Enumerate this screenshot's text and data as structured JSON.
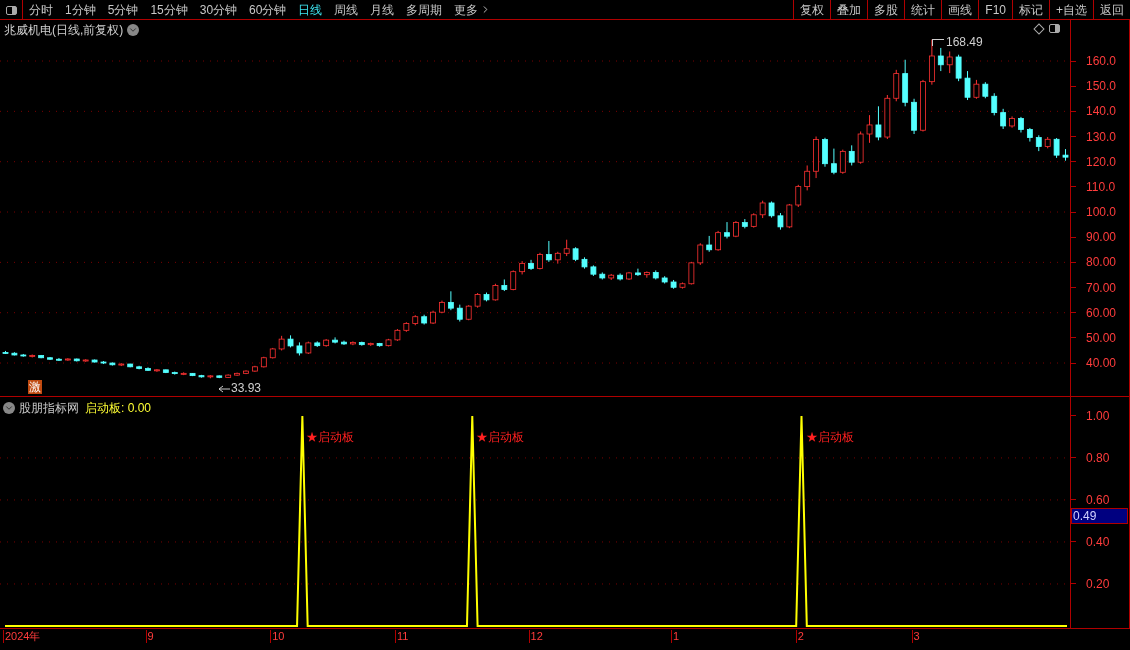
{
  "toolbar": {
    "periods": [
      {
        "label": "分时",
        "selected": false
      },
      {
        "label": "1分钟",
        "selected": false
      },
      {
        "label": "5分钟",
        "selected": false
      },
      {
        "label": "15分钟",
        "selected": false
      },
      {
        "label": "30分钟",
        "selected": false
      },
      {
        "label": "60分钟",
        "selected": false
      },
      {
        "label": "日线",
        "selected": true
      },
      {
        "label": "周线",
        "selected": false
      },
      {
        "label": "月线",
        "selected": false
      },
      {
        "label": "多周期",
        "selected": false
      },
      {
        "label": "更多",
        "selected": false
      }
    ],
    "actions": [
      "复权",
      "叠加",
      "多股",
      "统计",
      "画线",
      "F10",
      "标记",
      "+自选",
      "返回"
    ]
  },
  "price_pane": {
    "title": "兆威机电(日线,前复权)",
    "high_label": "168.49",
    "low_label": "33.93",
    "badge": "激",
    "chart_data": {
      "type": "candlestick",
      "ylim": [
        26.9,
        176.3
      ],
      "yticks": [
        {
          "value": 160,
          "label": "160.0"
        },
        {
          "value": 150,
          "label": "150.0"
        },
        {
          "value": 140,
          "label": "140.0"
        },
        {
          "value": 130,
          "label": "130.0"
        },
        {
          "value": 120,
          "label": "120.0"
        },
        {
          "value": 110,
          "label": "110.0"
        },
        {
          "value": 100,
          "label": "100.0"
        },
        {
          "value": 90,
          "label": "90.00"
        },
        {
          "value": 80,
          "label": "80.00"
        },
        {
          "value": 70,
          "label": "70.00"
        },
        {
          "value": 60,
          "label": "60.00"
        },
        {
          "value": 50,
          "label": "50.00"
        },
        {
          "value": 40,
          "label": "40.00"
        }
      ],
      "grid": true,
      "ohlc": [
        [
          44.2,
          44.8,
          43.6,
          43.9
        ],
        [
          43.9,
          44.3,
          43.0,
          43.2
        ],
        [
          43.2,
          43.6,
          42.5,
          42.8
        ],
        [
          42.8,
          43.4,
          42.2,
          43.0
        ],
        [
          43.0,
          43.2,
          41.9,
          42.1
        ],
        [
          42.1,
          42.4,
          41.2,
          41.5
        ],
        [
          41.5,
          42.0,
          40.8,
          41.2
        ],
        [
          41.2,
          41.9,
          40.9,
          41.6
        ],
        [
          41.6,
          41.8,
          40.6,
          40.9
        ],
        [
          40.9,
          41.5,
          40.5,
          41.2
        ],
        [
          41.2,
          41.4,
          40.2,
          40.4
        ],
        [
          40.4,
          40.8,
          39.6,
          40.0
        ],
        [
          40.0,
          40.2,
          39.0,
          39.3
        ],
        [
          39.3,
          39.9,
          38.8,
          39.6
        ],
        [
          39.6,
          39.7,
          38.3,
          38.5
        ],
        [
          38.5,
          38.9,
          37.5,
          37.8
        ],
        [
          37.8,
          38.3,
          36.9,
          37.1
        ],
        [
          37.1,
          37.6,
          36.5,
          37.3
        ],
        [
          37.3,
          37.4,
          36.0,
          36.2
        ],
        [
          36.2,
          36.6,
          35.4,
          35.8
        ],
        [
          35.8,
          36.3,
          35.2,
          35.9
        ],
        [
          35.9,
          36.0,
          34.8,
          35.0
        ],
        [
          35.0,
          35.3,
          34.2,
          34.5
        ],
        [
          34.5,
          35.2,
          33.93,
          34.9
        ],
        [
          34.9,
          35.1,
          34.0,
          34.3
        ],
        [
          34.3,
          35.5,
          34.1,
          35.2
        ],
        [
          35.2,
          36.2,
          34.9,
          35.9
        ],
        [
          35.9,
          37.1,
          35.6,
          36.8
        ],
        [
          36.8,
          38.9,
          36.5,
          38.5
        ],
        [
          38.5,
          42.5,
          38.2,
          42.1
        ],
        [
          42.1,
          46.0,
          41.8,
          45.6
        ],
        [
          45.6,
          50.8,
          45.0,
          49.5
        ],
        [
          49.5,
          51.0,
          46.2,
          46.8
        ],
        [
          46.8,
          48.2,
          43.0,
          44.0
        ],
        [
          44.0,
          48.5,
          43.6,
          48.0
        ],
        [
          48.0,
          48.6,
          46.4,
          46.9
        ],
        [
          46.9,
          49.5,
          46.5,
          49.1
        ],
        [
          49.1,
          50.2,
          47.8,
          48.3
        ],
        [
          48.3,
          48.9,
          47.2,
          47.6
        ],
        [
          47.6,
          48.6,
          47.1,
          48.2
        ],
        [
          48.2,
          48.5,
          46.9,
          47.3
        ],
        [
          47.3,
          48.1,
          46.8,
          47.8
        ],
        [
          47.8,
          48.0,
          46.5,
          46.9
        ],
        [
          46.9,
          49.6,
          46.6,
          49.2
        ],
        [
          49.2,
          53.5,
          48.8,
          53.0
        ],
        [
          53.0,
          56.2,
          52.4,
          55.7
        ],
        [
          55.7,
          59.0,
          55.0,
          58.4
        ],
        [
          58.4,
          59.2,
          55.3,
          55.9
        ],
        [
          55.9,
          60.8,
          55.5,
          60.2
        ],
        [
          60.2,
          64.8,
          59.8,
          64.1
        ],
        [
          64.1,
          68.5,
          61.0,
          61.8
        ],
        [
          61.8,
          63.2,
          56.5,
          57.4
        ],
        [
          57.4,
          63.0,
          57.0,
          62.6
        ],
        [
          62.6,
          67.8,
          62.0,
          67.2
        ],
        [
          67.2,
          68.0,
          64.5,
          65.1
        ],
        [
          65.1,
          71.5,
          64.8,
          70.8
        ],
        [
          70.8,
          73.2,
          68.6,
          69.2
        ],
        [
          69.2,
          76.8,
          68.9,
          76.3
        ],
        [
          76.3,
          80.5,
          75.2,
          79.6
        ],
        [
          79.6,
          81.0,
          77.0,
          77.6
        ],
        [
          77.6,
          83.8,
          77.2,
          83.1
        ],
        [
          83.1,
          88.5,
          80.2,
          81.0
        ],
        [
          81.0,
          84.2,
          79.5,
          83.6
        ],
        [
          83.6,
          89.0,
          82.5,
          85.4
        ],
        [
          85.4,
          86.0,
          80.5,
          81.2
        ],
        [
          81.2,
          82.0,
          77.5,
          78.2
        ],
        [
          78.2,
          78.8,
          74.6,
          75.3
        ],
        [
          75.3,
          76.0,
          73.2,
          73.8
        ],
        [
          73.8,
          75.4,
          73.0,
          74.9
        ],
        [
          74.9,
          75.6,
          72.8,
          73.4
        ],
        [
          73.4,
          76.2,
          73.0,
          75.8
        ],
        [
          75.8,
          77.5,
          74.6,
          75.1
        ],
        [
          75.1,
          76.4,
          73.9,
          76.0
        ],
        [
          76.0,
          76.8,
          73.2,
          73.8
        ],
        [
          73.8,
          74.5,
          71.6,
          72.2
        ],
        [
          72.2,
          73.0,
          69.5,
          70.1
        ],
        [
          70.1,
          72.0,
          69.6,
          71.5
        ],
        [
          71.5,
          80.2,
          71.2,
          79.8
        ],
        [
          79.8,
          87.6,
          79.0,
          86.9
        ],
        [
          86.9,
          90.5,
          84.2,
          85.0
        ],
        [
          85.0,
          92.5,
          84.6,
          91.8
        ],
        [
          91.8,
          96.0,
          89.5,
          90.4
        ],
        [
          90.4,
          96.4,
          90.0,
          95.8
        ],
        [
          95.8,
          97.2,
          93.5,
          94.3
        ],
        [
          94.3,
          99.5,
          93.8,
          98.9
        ],
        [
          98.9,
          104.5,
          97.6,
          103.6
        ],
        [
          103.6,
          104.2,
          97.8,
          98.5
        ],
        [
          98.5,
          99.6,
          93.0,
          94.1
        ],
        [
          94.1,
          103.2,
          93.6,
          102.8
        ],
        [
          102.8,
          110.8,
          102.0,
          110.1
        ],
        [
          110.1,
          118.5,
          108.6,
          116.2
        ],
        [
          116.2,
          130.0,
          113.5,
          128.8
        ],
        [
          128.8,
          129.5,
          118.0,
          119.2
        ],
        [
          119.2,
          125.2,
          115.0,
          115.8
        ],
        [
          115.8,
          124.8,
          115.2,
          124.1
        ],
        [
          124.1,
          126.5,
          118.5,
          119.8
        ],
        [
          119.8,
          132.0,
          119.2,
          131.0
        ],
        [
          131.0,
          138.5,
          127.5,
          134.6
        ],
        [
          134.6,
          142.0,
          128.5,
          129.8
        ],
        [
          129.8,
          146.5,
          129.0,
          145.2
        ],
        [
          145.2,
          156.5,
          144.0,
          155.0
        ],
        [
          155.0,
          160.5,
          142.0,
          143.6
        ],
        [
          143.6,
          145.0,
          131.0,
          132.5
        ],
        [
          132.5,
          152.5,
          132.0,
          151.8
        ],
        [
          151.8,
          168.49,
          150.6,
          162.0
        ],
        [
          162.0,
          165.2,
          156.0,
          158.5
        ],
        [
          158.5,
          163.8,
          155.2,
          161.6
        ],
        [
          161.6,
          162.5,
          152.0,
          153.2
        ],
        [
          153.2,
          156.0,
          144.5,
          145.6
        ],
        [
          145.6,
          152.5,
          145.0,
          150.8
        ],
        [
          150.8,
          151.6,
          145.2,
          146.0
        ],
        [
          146.0,
          147.2,
          138.4,
          139.5
        ],
        [
          139.5,
          141.0,
          133.0,
          134.2
        ],
        [
          134.2,
          138.0,
          133.5,
          137.2
        ],
        [
          137.2,
          137.8,
          131.6,
          132.8
        ],
        [
          132.8,
          133.4,
          128.0,
          129.6
        ],
        [
          129.6,
          130.5,
          124.2,
          126.0
        ],
        [
          126.0,
          129.8,
          125.3,
          128.9
        ],
        [
          128.9,
          129.4,
          121.5,
          122.6
        ],
        [
          122.6,
          125.0,
          120.4,
          121.8
        ]
      ]
    }
  },
  "indicator_pane": {
    "name": "股朋指标网",
    "reading": ": 0.00",
    "signals": [
      "★启动板",
      "★启动板",
      "★启动板"
    ],
    "cursor_value": "0.49",
    "chart_data": {
      "type": "line",
      "grid": true,
      "ylim": [
        0,
        1.09
      ],
      "yticks": [
        {
          "value": 1,
          "label": "1.00"
        },
        {
          "value": 0.8,
          "label": "0.80"
        },
        {
          "value": 0.6,
          "label": "0.60"
        },
        {
          "value": 0.4,
          "label": "0.40"
        },
        {
          "value": 0.2,
          "label": "0.20"
        }
      ],
      "series": [
        {
          "name": "启动板",
          "color": "#ffff00",
          "values": [
            0,
            0,
            0,
            0,
            0,
            0,
            0,
            0,
            0,
            0,
            0,
            0,
            0,
            0,
            0,
            0,
            0,
            0,
            0,
            0,
            0,
            0,
            0,
            0,
            0,
            0,
            0,
            0,
            0,
            0,
            0,
            0,
            0,
            0,
            0,
            0,
            0,
            0,
            0,
            0,
            0,
            0,
            0,
            0,
            0,
            0,
            0,
            0,
            0,
            0,
            0,
            0,
            0,
            0,
            0,
            0,
            1,
            0,
            0,
            0,
            0,
            0,
            0,
            0,
            0,
            0,
            0,
            0,
            0,
            0,
            0,
            0,
            0,
            0,
            0,
            0,
            0,
            0,
            0,
            0,
            0,
            0,
            0,
            0,
            0,
            0,
            0,
            0,
            1,
            0,
            0,
            0,
            0,
            0,
            0,
            0,
            0,
            0,
            0,
            0,
            0,
            0,
            0,
            0,
            0,
            0,
            0,
            0,
            0,
            0,
            0,
            0,
            0,
            0,
            0,
            0,
            0,
            0,
            0,
            0,
            0,
            0,
            0,
            0,
            0,
            0,
            0,
            0,
            0,
            0,
            0,
            0,
            0,
            0,
            0,
            0,
            0,
            0,
            0,
            0,
            0,
            0,
            0,
            0,
            0,
            0,
            0,
            0,
            0,
            0,
            1,
            0,
            0,
            0,
            0,
            0,
            0,
            0,
            0,
            0,
            0,
            0,
            0,
            0,
            0,
            0,
            0,
            0,
            0,
            0,
            0,
            0,
            0,
            0,
            0,
            0,
            0,
            0,
            0,
            0,
            0,
            0,
            0,
            0,
            0,
            0,
            0,
            0,
            0,
            0,
            0,
            0,
            0,
            0,
            0,
            0,
            0,
            0,
            0,
            0,
            0
          ]
        }
      ]
    }
  },
  "time_axis": [
    "2024年",
    "9",
    "10",
    "11",
    "12",
    "1",
    "2",
    "3"
  ]
}
